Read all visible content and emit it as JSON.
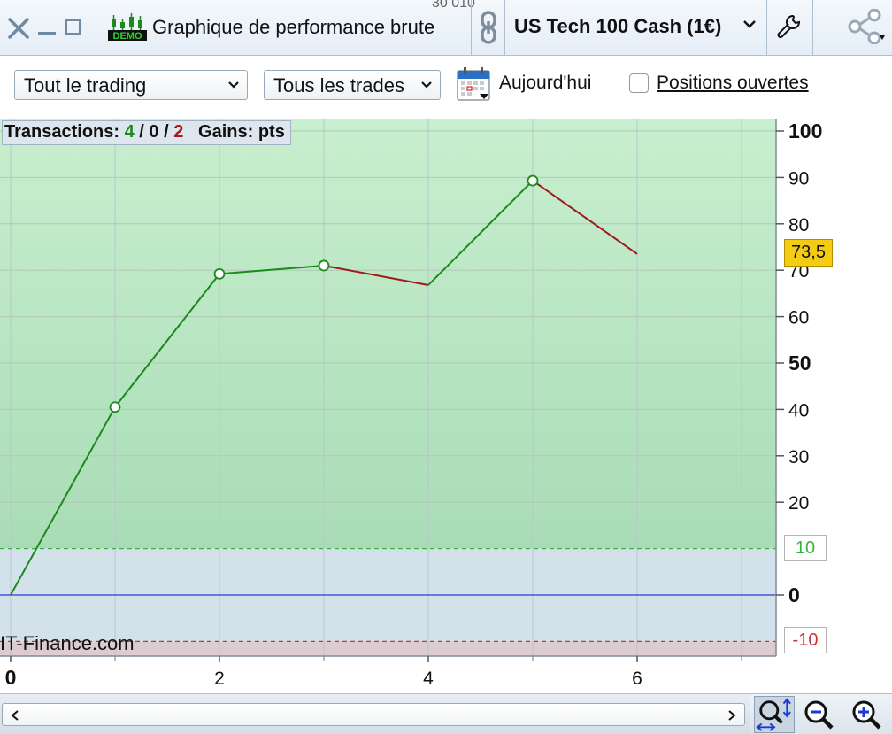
{
  "window": {
    "title": "Graphique de performance brute",
    "instrument": "US Tech 100 Cash (1€)",
    "demo_badge": "DEMO",
    "top_stub": "30 010"
  },
  "toolbar": {
    "trading_filter": "Tout le trading",
    "trades_filter": "Tous les trades",
    "date_label": "Aujourd'hui",
    "open_positions_label": "Positions ouvertes",
    "open_positions_checked": false
  },
  "stats": {
    "transactions_label": "Transactions:",
    "won": "4",
    "sep1": "/",
    "neutral": "0",
    "sep2": "/",
    "lost": "2",
    "gains_label": "Gains:",
    "gains_unit": "pts"
  },
  "watermark": "IT-Finance.com",
  "price_badge": "73,5",
  "threshold_high_label": "10",
  "threshold_low_label": "-10",
  "colors": {
    "up": "#1a8a1a",
    "down": "#a01a1a",
    "zero_line": "#2b3ad6",
    "threshold_high": "#39b539",
    "threshold_low": "#cc3333",
    "badge": "#f5cc14"
  },
  "chart_data": {
    "type": "line",
    "x": [
      0,
      1,
      2,
      3,
      4,
      5,
      6
    ],
    "y": [
      0,
      40.5,
      69.2,
      71,
      66.8,
      89.3,
      73.5
    ],
    "segment_colors": [
      "up",
      "up",
      "up",
      "down",
      "up",
      "down"
    ],
    "markers_at": [
      1,
      2,
      3,
      5
    ],
    "xlim": [
      0,
      7.2
    ],
    "ylim": [
      -13,
      103.5
    ],
    "x_ticks": [
      {
        "v": 0,
        "label": "0",
        "bold": true
      },
      {
        "v": 2,
        "label": "2",
        "bold": false
      },
      {
        "v": 4,
        "label": "4",
        "bold": false
      },
      {
        "v": 6,
        "label": "6",
        "bold": false
      }
    ],
    "y_ticks": [
      {
        "v": 100,
        "label": "100",
        "bold": true
      },
      {
        "v": 90,
        "label": "90",
        "bold": false
      },
      {
        "v": 80,
        "label": "80",
        "bold": false
      },
      {
        "v": 70,
        "label": "70",
        "bold": false
      },
      {
        "v": 60,
        "label": "60",
        "bold": false
      },
      {
        "v": 50,
        "label": "50",
        "bold": true
      },
      {
        "v": 40,
        "label": "40",
        "bold": false
      },
      {
        "v": 30,
        "label": "30",
        "bold": false
      },
      {
        "v": 20,
        "label": "20",
        "bold": false
      },
      {
        "v": 0,
        "label": "0",
        "bold": true
      }
    ],
    "thresholds": [
      10,
      -10
    ],
    "grid": true
  }
}
